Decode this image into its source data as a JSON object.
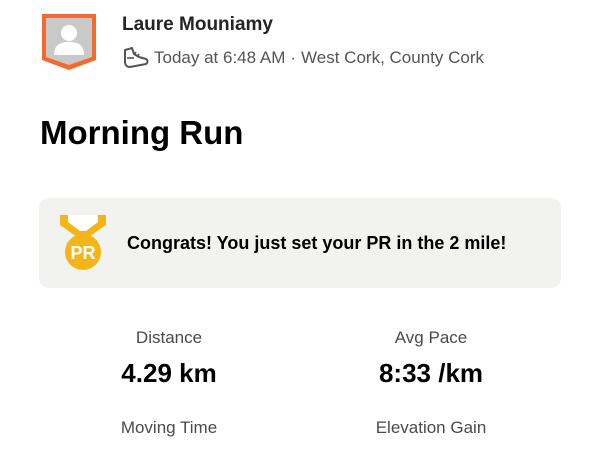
{
  "activity": {
    "athlete_name": "Laure Mouniamy",
    "time": "Today at 6:48 AM",
    "separator": "·",
    "location": "West Cork, County Cork",
    "title": "Morning Run"
  },
  "achievement": {
    "medal_text": "PR",
    "message": "Congrats! You just set your PR in the 2 mile!",
    "medal_color": "#f3b51a"
  },
  "stats": {
    "distance": {
      "label": "Distance",
      "value": "4.29 km"
    },
    "pace": {
      "label": "Avg Pace",
      "value": "8:33 /km"
    },
    "moving_time": {
      "label": "Moving Time"
    },
    "elevation": {
      "label": "Elevation Gain"
    }
  },
  "colors": {
    "avatar_frame": "#f26b2d",
    "avatar_fill": "#c8c8c8",
    "card_background": "#f2f2f0"
  },
  "icons": {
    "avatar": "athlete-avatar-placeholder",
    "meta": "running-shoe-icon",
    "achievement": "pr-medal-icon"
  }
}
